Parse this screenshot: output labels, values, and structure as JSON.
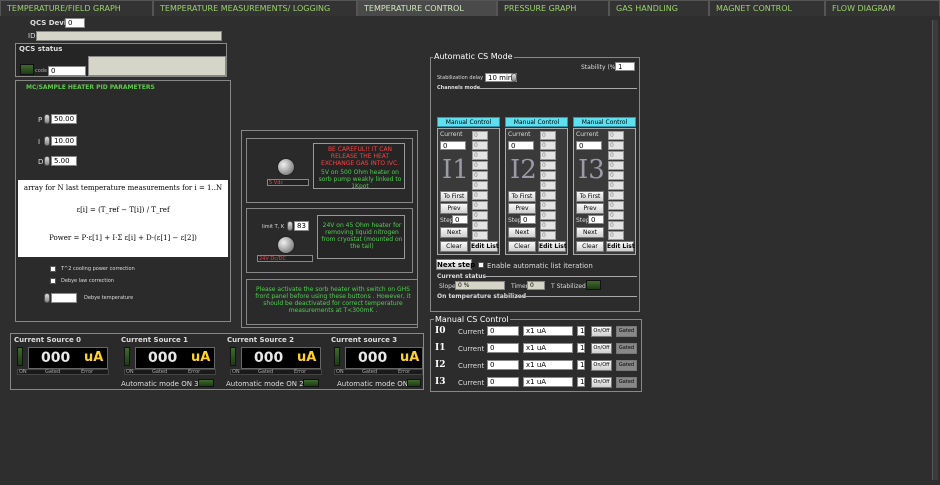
{
  "tabs": [
    "TEMPERATURE/FIELD GRAPH",
    "TEMPERATURE  MEASUREMENTS/ LOGGING",
    "TEMPERATURE CONTROL",
    "PRESSURE GRAPH",
    "GAS HANDLING",
    "MAGNET CONTROL",
    "FLOW DIAGRAM"
  ],
  "active_tab": 2,
  "qcs": {
    "device_label": "QCS Device",
    "device_value": "0",
    "id_label": "ID",
    "status_label": "QCS status",
    "code_label": "code",
    "code_value": "0"
  },
  "pid": {
    "title": "MC/SAMPLE HEATER PID PARAMETERS",
    "p_label": "P",
    "p_value": "50.00",
    "i_label": "I",
    "i_value": "10.00",
    "d_label": "D",
    "d_value": "5.00",
    "formula_caption": "array for N last temperature measurements for i = 1..N",
    "formula_eps": "ε[i] = (T_ref − T[i]) / T_ref",
    "formula_power": "Power = P·ε[1] + I·Σ ε[i] + D·(ε[1] − ε[2])",
    "opt1": "T^2 cooling power correction",
    "opt2": "Debye law correction",
    "opt3": "Debye temperature"
  },
  "heater": {
    "warn_red": "BE CAREFUL!! IT CAN RELEASE THE HEAT EXCHANGE GAS INTO IVC.",
    "warn_green": "5V on 500 Ohm heater on sorb pump weakly linked to 1Kpot",
    "led1_label": "5 Vdc",
    "limit_label": "limit T, K",
    "limit_value": "83",
    "info2": "24V on 45 Ohm heater for removing liquid nitrogen from cryostat (mounted on the tail)",
    "led2_label": "24V Dc/DC",
    "note": "Please activate the sorb heater with switch on GHS front panel before using these buttons . However, it should be deactivated for correct temperature measurements at T<300mK ."
  },
  "current_sources": [
    {
      "title": "Current Source 0",
      "value": "000",
      "unit": "uA",
      "auto": ""
    },
    {
      "title": "Current Source 1",
      "value": "000",
      "unit": "uA",
      "auto": "Automatic mode ON 3"
    },
    {
      "title": "Current Source 2",
      "value": "000",
      "unit": "uA",
      "auto": "Automatic mode ON 2"
    },
    {
      "title": "Current source 3",
      "value": "000",
      "unit": "uA",
      "auto": "Automatic mode ON"
    }
  ],
  "cs_small": {
    "on": "ON",
    "gated": "Gated",
    "error": "Error"
  },
  "auto_cs": {
    "title": "Automatic CS Mode",
    "stability_label": "Stability (%)",
    "stability_value": "1",
    "delay_label": "Stabilization delay",
    "delay_value": "10 min",
    "channels_label": "Channels mode",
    "channels": [
      {
        "header": "Manual Control",
        "current_label": "Current",
        "current_value": "0",
        "big": "I1",
        "list": [
          "0",
          "0",
          "0",
          "0",
          "0",
          "0",
          "0",
          "0",
          "0",
          "0",
          "0",
          "0"
        ]
      },
      {
        "header": "Manual Control",
        "current_label": "Current",
        "current_value": "0",
        "big": "I2",
        "list": [
          "0",
          "0",
          "0",
          "0",
          "0",
          "0",
          "0",
          "0",
          "0",
          "0",
          "0",
          "0"
        ]
      },
      {
        "header": "Manual Control",
        "current_label": "Current",
        "current_value": "0",
        "big": "I3",
        "list": [
          "0",
          "0",
          "0",
          "0",
          "0",
          "0",
          "0",
          "0",
          "0",
          "0",
          "0",
          "0"
        ]
      }
    ],
    "btn_first": "To First",
    "btn_prev": "Prev",
    "step_label": "Step",
    "step_value": "0",
    "btn_next": "Next",
    "btn_clear": "Clear",
    "btn_edit": "Edit List",
    "next_step": "Next step",
    "enable_iter": "Enable automatic list iteration",
    "status_label": "Current status",
    "slope_label": "Slope",
    "slope_value": "0 %",
    "timer_label": "Timer",
    "timer_value": "0",
    "tstab_label": "T Stabilized?",
    "on_stab_label": "On temperature stabilized"
  },
  "manual_cs": {
    "title": "Manual CS Control",
    "rows": [
      {
        "label": "I0",
        "current_label": "Current",
        "current": "0",
        "range": "x1 uA",
        "mult": "1",
        "onoff": "On/Off",
        "gated": "Gated"
      },
      {
        "label": "I1",
        "current_label": "Current",
        "current": "0",
        "range": "x1 uA",
        "mult": "1",
        "onoff": "On/Off",
        "gated": "Gated"
      },
      {
        "label": "I2",
        "current_label": "Current",
        "current": "0",
        "range": "x1 uA",
        "mult": "1",
        "onoff": "On/Off",
        "gated": "Gated"
      },
      {
        "label": "I3",
        "current_label": "Current",
        "current": "0",
        "range": "x1 uA",
        "mult": "1",
        "onoff": "On/Off",
        "gated": "Gated"
      }
    ]
  },
  "colors": {
    "background": "#2e2e2e",
    "tab_text": "#9ad36a",
    "warn": "#ff4040",
    "info": "#4fd04f",
    "accent_cyan": "#5fe0f0",
    "unit_yellow": "#ffd12e"
  }
}
